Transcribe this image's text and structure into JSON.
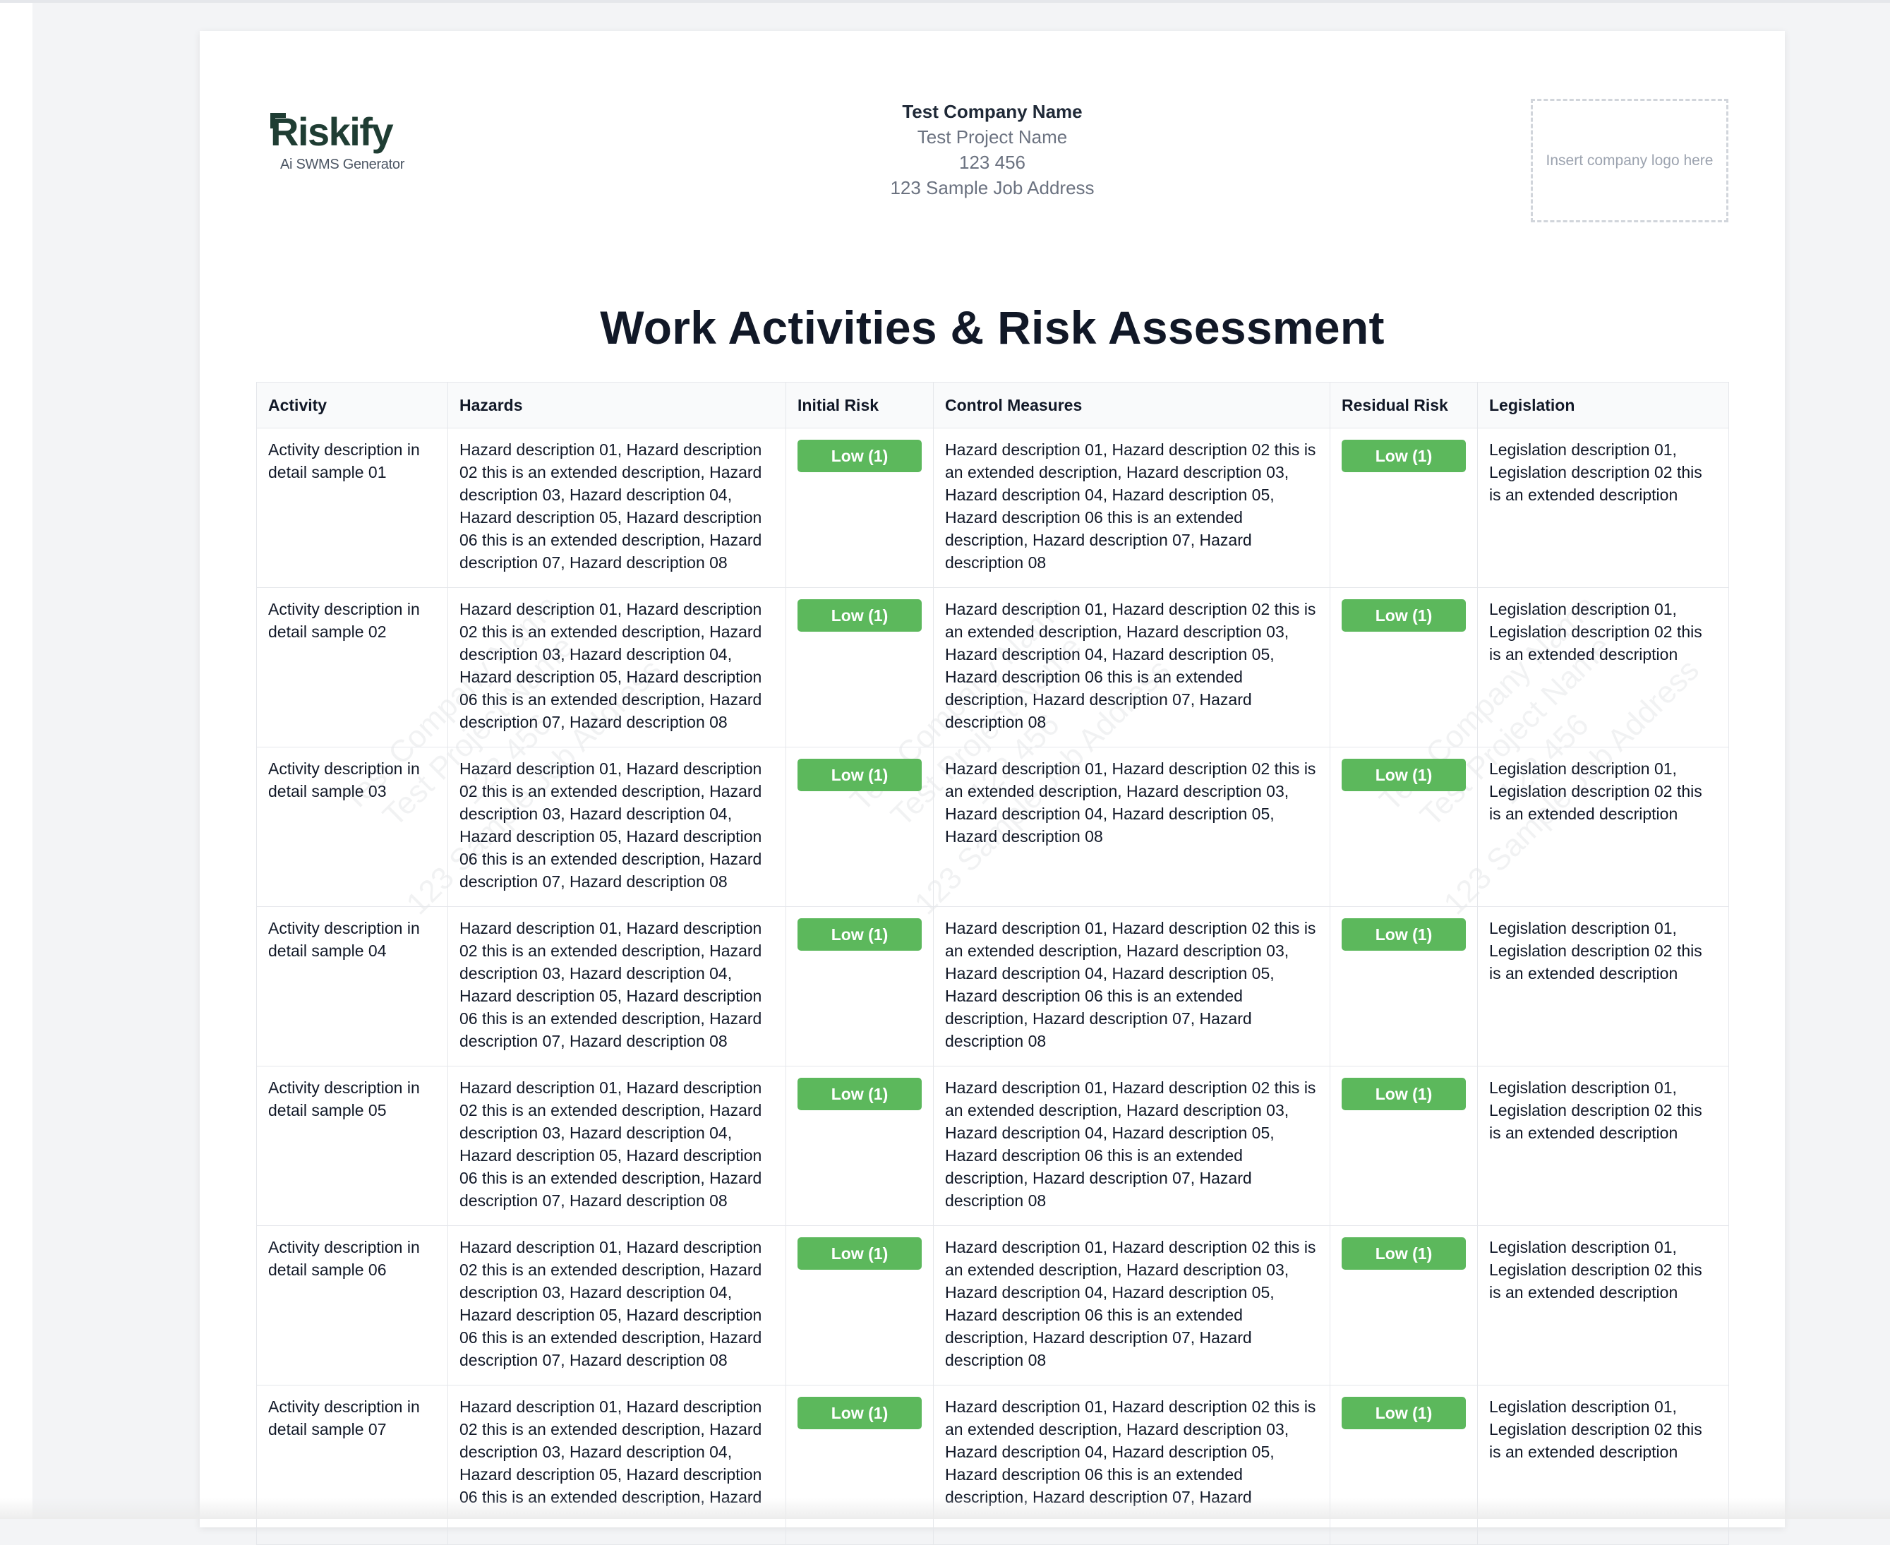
{
  "header": {
    "brand": {
      "wordmark": "Riskify",
      "tagline": "Ai SWMS Generator"
    },
    "company_name": "Test Company Name",
    "project_name": "Test Project Name",
    "project_number": "123 456",
    "job_address": "123 Sample Job Address",
    "logo_placeholder": "Insert company logo here"
  },
  "title": "Work Activities & Risk Assessment",
  "watermark": {
    "lines": [
      "Test Company Name",
      "Test Project Name",
      "123 456",
      "123 Sample Job Address"
    ]
  },
  "table": {
    "columns": [
      "Activity",
      "Hazards",
      "Initial Risk",
      "Control Measures",
      "Residual Risk",
      "Legislation"
    ],
    "rows": [
      {
        "activity": "Activity description in detail sample 01",
        "hazards": "Hazard description 01, Hazard description 02 this is an extended description, Hazard description 03, Hazard description 04, Hazard description 05, Hazard description 06 this is an extended description, Hazard description 07, Hazard description 08",
        "initial_risk": "Low (1)",
        "controls": "Hazard description 01, Hazard description 02 this is an extended description, Hazard description 03, Hazard description 04, Hazard description 05, Hazard description 06 this is an extended description, Hazard description 07, Hazard description 08",
        "residual_risk": "Low (1)",
        "legislation": "Legislation description 01, Legislation description 02 this is an extended description"
      },
      {
        "activity": "Activity description in detail sample 02",
        "hazards": "Hazard description 01, Hazard description 02 this is an extended description, Hazard description 03, Hazard description 04, Hazard description 05, Hazard description 06 this is an extended description, Hazard description 07, Hazard description 08",
        "initial_risk": "Low (1)",
        "controls": "Hazard description 01, Hazard description 02 this is an extended description, Hazard description 03, Hazard description 04, Hazard description 05, Hazard description 06 this is an extended description, Hazard description 07, Hazard description 08",
        "residual_risk": "Low (1)",
        "legislation": "Legislation description 01, Legislation description 02 this is an extended description"
      },
      {
        "activity": "Activity description in detail sample 03",
        "hazards": "Hazard description 01, Hazard description 02 this is an extended description, Hazard description 03, Hazard description 04, Hazard description 05, Hazard description 06 this is an extended description, Hazard description 07, Hazard description 08",
        "initial_risk": "Low (1)",
        "controls": "Hazard description 01, Hazard description 02 this is an extended description, Hazard description 03, Hazard description 04, Hazard description 05, Hazard description 08",
        "residual_risk": "Low (1)",
        "legislation": "Legislation description 01, Legislation description 02 this is an extended description"
      },
      {
        "activity": "Activity description in detail sample 04",
        "hazards": "Hazard description 01, Hazard description 02 this is an extended description, Hazard description 03, Hazard description 04, Hazard description 05, Hazard description 06 this is an extended description, Hazard description 07, Hazard description 08",
        "initial_risk": "Low (1)",
        "controls": "Hazard description 01, Hazard description 02 this is an extended description, Hazard description 03, Hazard description 04, Hazard description 05, Hazard description 06 this is an extended description, Hazard description 07, Hazard description 08",
        "residual_risk": "Low (1)",
        "legislation": "Legislation description 01, Legislation description 02 this is an extended description"
      },
      {
        "activity": "Activity description in detail sample 05",
        "hazards": "Hazard description 01, Hazard description 02 this is an extended description, Hazard description 03, Hazard description 04, Hazard description 05, Hazard description 06 this is an extended description, Hazard description 07, Hazard description 08",
        "initial_risk": "Low (1)",
        "controls": "Hazard description 01, Hazard description 02 this is an extended description, Hazard description 03, Hazard description 04, Hazard description 05, Hazard description 06 this is an extended description, Hazard description 07, Hazard description 08",
        "residual_risk": "Low (1)",
        "legislation": "Legislation description 01, Legislation description 02 this is an extended description"
      },
      {
        "activity": "Activity description in detail sample 06",
        "hazards": "Hazard description 01, Hazard description 02 this is an extended description, Hazard description 03, Hazard description 04, Hazard description 05, Hazard description 06 this is an extended description, Hazard description 07, Hazard description 08",
        "initial_risk": "Low (1)",
        "controls": "Hazard description 01, Hazard description 02 this is an extended description, Hazard description 03, Hazard description 04, Hazard description 05, Hazard description 06 this is an extended description, Hazard description 07, Hazard description 08",
        "residual_risk": "Low (1)",
        "legislation": "Legislation description 01, Legislation description 02 this is an extended description"
      },
      {
        "activity": "Activity description in detail sample 07",
        "hazards": "Hazard description 01, Hazard description 02 this is an extended description, Hazard description 03, Hazard description 04, Hazard description 05, Hazard description 06 this is an extended description, Hazard",
        "initial_risk": "Low (1)",
        "controls": "Hazard description 01, Hazard description 02 this is an extended description, Hazard description 03, Hazard description 04, Hazard description 05, Hazard description 06 this is an extended description, Hazard description 07, Hazard",
        "residual_risk": "Low (1)",
        "legislation": "Legislation description 01, Legislation description 02 this is an extended description"
      }
    ]
  },
  "colors": {
    "badge_low": "#5cb85c",
    "brand_green": "#1f3d33",
    "page_bg": "#f3f4f6"
  }
}
